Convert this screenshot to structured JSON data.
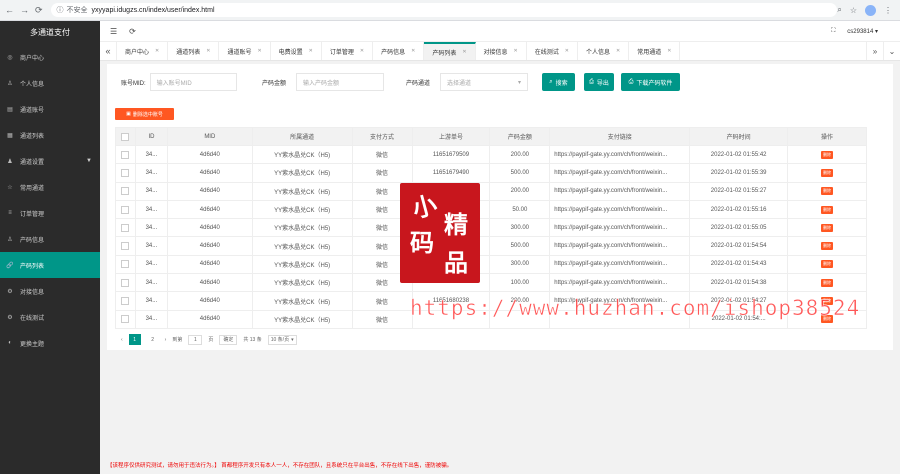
{
  "browser": {
    "security": "不安全",
    "url": "yxyyapi.idugzs.cn/index/user/index.html"
  },
  "sidebar": {
    "title": "多通道支付",
    "items": [
      {
        "label": "商户中心",
        "icon": "circle-icon"
      },
      {
        "label": "个人信息",
        "icon": "user-icon"
      },
      {
        "label": "通道账号",
        "icon": "list-icon"
      },
      {
        "label": "通道列表",
        "icon": "grid-icon"
      },
      {
        "label": "通道设置",
        "icon": "users-icon"
      },
      {
        "label": "常用通道",
        "icon": "star-icon"
      },
      {
        "label": "订单管理",
        "icon": "menu-icon"
      },
      {
        "label": "产码信息",
        "icon": "user-icon"
      },
      {
        "label": "产码列表",
        "icon": "link-icon"
      },
      {
        "label": "对接信息",
        "icon": "gear-icon"
      },
      {
        "label": "在线测试",
        "icon": "gear-icon"
      },
      {
        "label": "更换主题",
        "icon": "theme-icon"
      }
    ]
  },
  "topbar": {
    "username": "cs293814"
  },
  "tabs": [
    "商户中心",
    "通道列表",
    "通道账号",
    "电费设置",
    "订单管理",
    "产码信息",
    "产码列表",
    "对接信息",
    "在线测试",
    "个人信息",
    "常用通道"
  ],
  "filters": {
    "account_label": "账号MID:",
    "account_placeholder": "输入账号MID",
    "amount_label": "产码金额",
    "amount_placeholder": "输入产码金额",
    "channel_label": "产码通道",
    "channel_placeholder": "选择通道"
  },
  "buttons": {
    "search": "搜索",
    "export": "导出",
    "download": "下载产码软件",
    "delete_selected": "删除选中账号"
  },
  "table": {
    "headers": [
      "ID",
      "MID",
      "所属通道",
      "支付方式",
      "上游单号",
      "产码金额",
      "支付链接",
      "产码时间",
      "操作"
    ],
    "delete_label": "删除",
    "rows": [
      [
        "34...",
        "4d6d40",
        "YY紫水晶兑CK（H5)",
        "微信",
        "11651679509",
        "200.00",
        "https://paypif-gate.yy.com/ch/front/weixin...",
        "2022-01-02 01:55:42"
      ],
      [
        "34...",
        "4d6d40",
        "YY紫水晶兑CK（H5)",
        "微信",
        "11651679490",
        "500.00",
        "https://paypif-gate.yy.com/ch/front/weixin...",
        "2022-01-02 01:55:39"
      ],
      [
        "34...",
        "4d6d40",
        "YY紫水晶兑CK（H5)",
        "微信",
        "",
        "200.00",
        "https://paypif-gate.yy.com/ch/front/weixin...",
        "2022-01-02 01:55:27"
      ],
      [
        "34...",
        "4d6d40",
        "YY紫水晶兑CK（H5)",
        "微信",
        "",
        "50.00",
        "https://paypif-gate.yy.com/ch/front/weixin...",
        "2022-01-02 01:55:16"
      ],
      [
        "34...",
        "4d6d40",
        "YY紫水晶兑CK（H5)",
        "微信",
        "",
        "300.00",
        "https://paypif-gate.yy.com/ch/front/weixin...",
        "2022-01-02 01:55:05"
      ],
      [
        "34...",
        "4d6d40",
        "YY紫水晶兑CK（H5)",
        "微信",
        "",
        "500.00",
        "https://paypif-gate.yy.com/ch/front/weixin...",
        "2022-01-02 01:54:54"
      ],
      [
        "34...",
        "4d6d40",
        "YY紫水晶兑CK（H5)",
        "微信",
        "",
        "300.00",
        "https://paypif-gate.yy.com/ch/front/weixin...",
        "2022-01-02 01:54:43"
      ],
      [
        "34...",
        "4d6d40",
        "YY紫水晶兑CK（H5)",
        "微信",
        "",
        "100.00",
        "https://paypif-gate.yy.com/ch/front/weixin...",
        "2022-01-02 01:54:38"
      ],
      [
        "34...",
        "4d6d40",
        "YY紫水晶兑CK（H5)",
        "微信",
        "11651680238",
        "200.00",
        "https://paypif-gate.yy.com/ch/front/weixin...",
        "2022-01-02 01:54:27"
      ],
      [
        "34...",
        "4d6d40",
        "YY紫水晶兑CK（H5)",
        "微信",
        "",
        "",
        "",
        "2022-01-02 01:54:..."
      ]
    ]
  },
  "pager": {
    "pages": [
      "1",
      "2"
    ],
    "goto_label": "到第",
    "goto_value": "1",
    "page_unit": "页",
    "confirm": "确定",
    "total": "共 13 条",
    "per_page": "10 条/页"
  },
  "footer": "【该程序仅供研究测试，请勿用于违法行为。】 首都程序开发只有本人一人，不存在团队，且系统只在平台出售，不存在线下出售，谨防被骗。",
  "stamp": {
    "chars": [
      "小",
      "精",
      "码",
      "品"
    ]
  },
  "watermark": "https://www.huzhan.com/ishop38524",
  "colors": {
    "primary": "#009688",
    "danger": "#ff5722",
    "sidebar": "#2b2b2b"
  }
}
